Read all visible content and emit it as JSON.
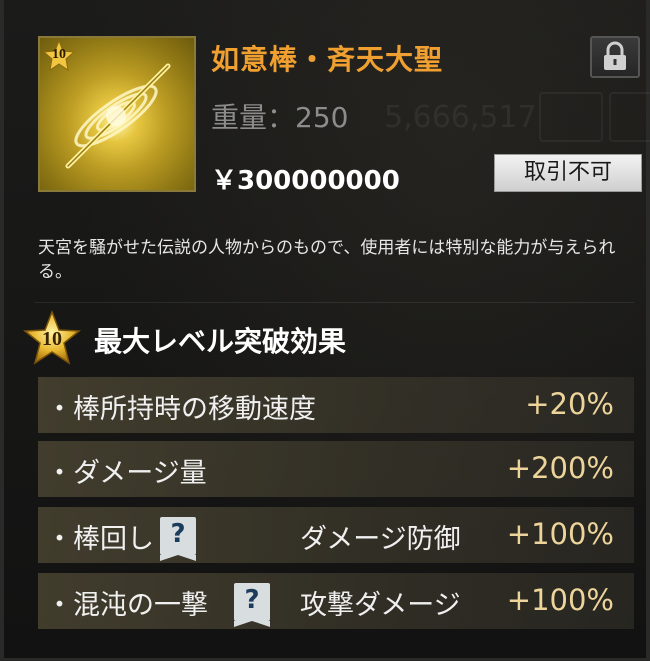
{
  "item": {
    "name": "如意棒・斉天大聖",
    "weight": "重量：250",
    "price": "￥300000000",
    "level": "10",
    "trade_status": "取引不可",
    "lock_icon": "lock-icon",
    "description": "天宮を騒がせた伝説の人物からのもので、使用者には特別な能力が与えられる。"
  },
  "background_ghost": {
    "number": "5,666,517"
  },
  "section": {
    "level": "10",
    "title": "最大レベル突破効果"
  },
  "effects": [
    {
      "name": "・棒所持時の移動速度",
      "sub": "",
      "value": "+20%",
      "has_help": false
    },
    {
      "name": "・ダメージ量",
      "sub": "",
      "value": "+200%",
      "has_help": false
    },
    {
      "name": "・棒回し",
      "sub": "ダメージ防御",
      "value": "+100%",
      "has_help": true,
      "help_label": "?"
    },
    {
      "name": "・混沌の一撃",
      "sub": "攻撃ダメージ",
      "value": "+100%",
      "has_help": true,
      "help_label": "?"
    }
  ],
  "colors": {
    "name": "#f0a030",
    "value": "#ecd49a",
    "icon_gold": "#e6c640"
  }
}
